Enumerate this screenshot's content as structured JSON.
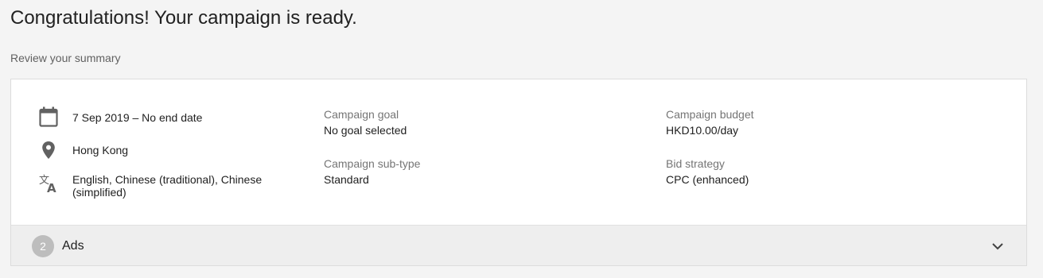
{
  "header": {
    "title": "Congratulations! Your campaign is ready.",
    "subtitle": "Review your summary"
  },
  "summary": {
    "schedule": {
      "icon": "calendar-icon",
      "text": "7 Sep 2019 – No end date"
    },
    "location": {
      "icon": "location-pin-icon",
      "text": "Hong Kong"
    },
    "languages": {
      "icon": "translate-icon",
      "text": "English, Chinese (traditional), Chinese (simplified)"
    },
    "campaign_goal": {
      "label": "Campaign goal",
      "value": "No goal selected"
    },
    "campaign_subtype": {
      "label": "Campaign sub-type",
      "value": "Standard"
    },
    "campaign_budget": {
      "label": "Campaign budget",
      "value": "HKD10.00/day"
    },
    "bid_strategy": {
      "label": "Bid strategy",
      "value": "CPC (enhanced)"
    }
  },
  "ads_section": {
    "step_number": "2",
    "label": "Ads",
    "expand_icon": "chevron-down-icon"
  },
  "colors": {
    "background": "#f4f4f4",
    "card": "#ffffff",
    "section_header": "#eeeeee",
    "badge": "#bdbdbd",
    "icon": "#616161"
  }
}
